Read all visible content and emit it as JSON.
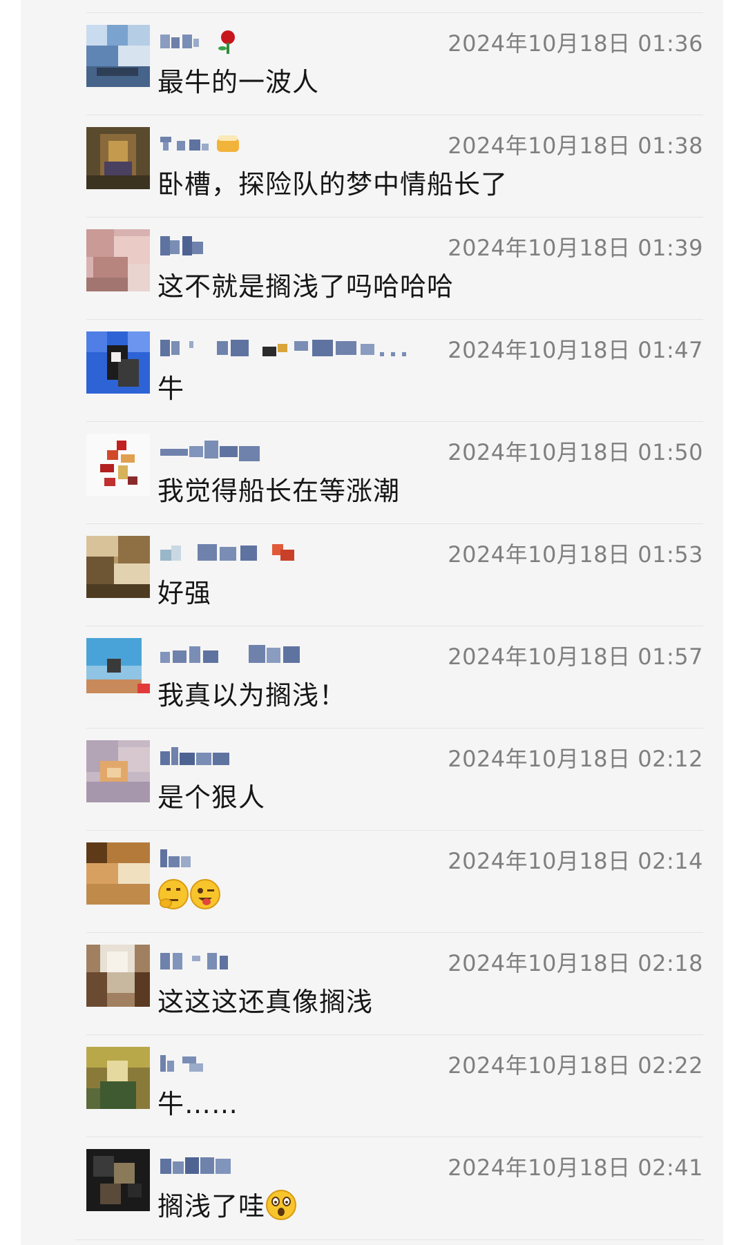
{
  "colors": {
    "panel_bg": "#f5f5f5",
    "name_blue": "#576b95",
    "time_gray": "#7f7f7f",
    "text": "#161616",
    "divider": "#e3e3e3"
  },
  "comments": [
    {
      "time": "2024年10月18日 01:36",
      "text": "最牛的一波人",
      "name_icon": "rose-icon"
    },
    {
      "time": "2024年10月18日 01:38",
      "text": "卧槽，探险队的梦中情船长了",
      "name_icon": "beer-icon"
    },
    {
      "time": "2024年10月18日 01:39",
      "text": "这不就是搁浅了吗哈哈哈"
    },
    {
      "time": "2024年10月18日 01:47",
      "text": "牛"
    },
    {
      "time": "2024年10月18日 01:50",
      "text": "我觉得船长在等涨潮"
    },
    {
      "time": "2024年10月18日 01:53",
      "text": "好强"
    },
    {
      "time": "2024年10月18日 01:57",
      "text": "我真以为搁浅！"
    },
    {
      "time": "2024年10月18日 02:12",
      "text": "是个狠人"
    },
    {
      "time": "2024年10月18日 02:14",
      "text": "",
      "emojis": [
        "thinking-face-emoji",
        "winking-tongue-emoji"
      ]
    },
    {
      "time": "2024年10月18日 02:18",
      "text": "这这这还真像搁浅"
    },
    {
      "time": "2024年10月18日 02:22",
      "text": "牛……"
    },
    {
      "time": "2024年10月18日 02:41",
      "text": "搁浅了哇",
      "emojis": [
        "astonished-face-emoji"
      ]
    }
  ]
}
